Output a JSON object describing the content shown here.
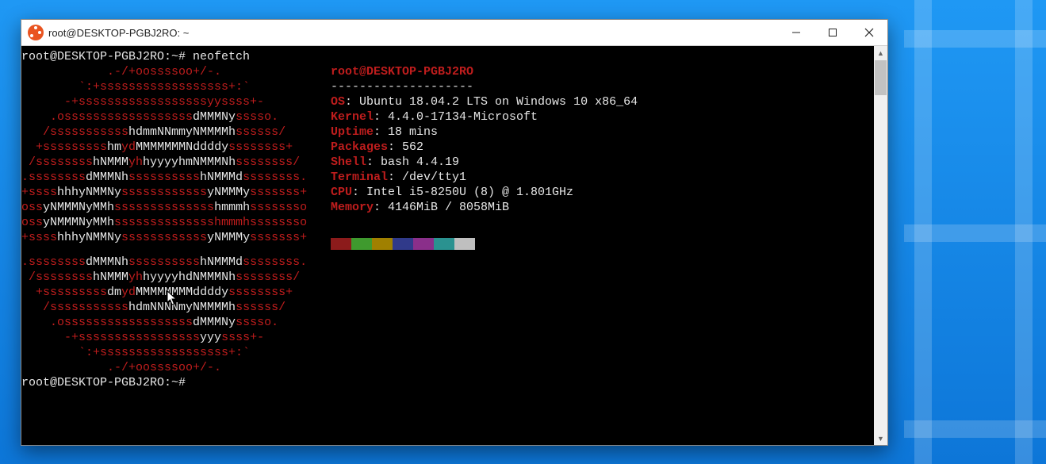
{
  "window": {
    "title": "root@DESKTOP-PGBJ2RO: ~"
  },
  "prompt": {
    "line1": "root@DESKTOP-PGBJ2RO:~# neofetch",
    "line2": "root@DESKTOP-PGBJ2RO:~# "
  },
  "neofetch": {
    "user_host": "root@DESKTOP-PGBJ2RO",
    "dashes": "--------------------",
    "fields": {
      "os_label": "OS",
      "os_value": ": Ubuntu 18.04.2 LTS on Windows 10 x86_64",
      "kernel_label": "Kernel",
      "kernel_value": ": 4.4.0-17134-Microsoft",
      "uptime_label": "Uptime",
      "uptime_value": ": 18 mins",
      "packages_label": "Packages",
      "packages_value": ": 562",
      "shell_label": "Shell",
      "shell_value": ": bash 4.4.19",
      "terminal_label": "Terminal",
      "terminal_value": ": /dev/tty1",
      "cpu_label": "CPU",
      "cpu_value": ": Intel i5-8250U (8) @ 1.801GHz",
      "memory_label": "Memory",
      "memory_value": ": 4146MiB / 8058MiB"
    },
    "swatch_colors": [
      "#8c1b1b",
      "#3f9a2e",
      "#a08000",
      "#303a8a",
      "#8a2f8a",
      "#2a9290",
      "#bfbfbf"
    ]
  },
  "ascii_art_rows": [
    [
      {
        "c": "r",
        "t": "            .-/+oossssoo+/-."
      }
    ],
    [
      {
        "c": "r",
        "t": "        `:+ssssssssssssssssss+:`"
      }
    ],
    [
      {
        "c": "r",
        "t": "      -+ssssssssssssssssssyyssss+-"
      }
    ],
    [
      {
        "c": "r",
        "t": "    .ossssssssssssssssss"
      },
      {
        "c": "w",
        "t": "dMMMNy"
      },
      {
        "c": "r",
        "t": "sssso."
      }
    ],
    [
      {
        "c": "r",
        "t": "   /sssssssssss"
      },
      {
        "c": "w",
        "t": "hdmmNNmmyNMMMMh"
      },
      {
        "c": "r",
        "t": "ssssss/"
      }
    ],
    [
      {
        "c": "r",
        "t": "  +sssssssss"
      },
      {
        "c": "w",
        "t": "hm"
      },
      {
        "c": "r",
        "t": "yd"
      },
      {
        "c": "w",
        "t": "MMMMMMMNddddy"
      },
      {
        "c": "r",
        "t": "ssssssss+"
      }
    ],
    [
      {
        "c": "r",
        "t": " /ssssssss"
      },
      {
        "c": "w",
        "t": "hNMMM"
      },
      {
        "c": "r",
        "t": "yh"
      },
      {
        "c": "w",
        "t": "hyyyyhmNMMMNh"
      },
      {
        "c": "r",
        "t": "ssssssss/"
      }
    ],
    [
      {
        "c": "r",
        "t": ".ssssssss"
      },
      {
        "c": "w",
        "t": "dMMMNh"
      },
      {
        "c": "r",
        "t": "ssssssssss"
      },
      {
        "c": "w",
        "t": "hNMMMd"
      },
      {
        "c": "r",
        "t": "ssssssss."
      }
    ],
    [
      {
        "c": "r",
        "t": "+ssss"
      },
      {
        "c": "w",
        "t": "hhhyNMMNy"
      },
      {
        "c": "r",
        "t": "ssssssssssss"
      },
      {
        "c": "w",
        "t": "yNMMMy"
      },
      {
        "c": "r",
        "t": "sssssss+"
      }
    ],
    [
      {
        "c": "r",
        "t": "oss"
      },
      {
        "c": "w",
        "t": "yNMMMNyMMh"
      },
      {
        "c": "r",
        "t": "ssssssssssssss"
      },
      {
        "c": "w",
        "t": "hmmmh"
      },
      {
        "c": "r",
        "t": "ssssssso"
      }
    ],
    [
      {
        "c": "r",
        "t": "oss"
      },
      {
        "c": "w",
        "t": "yNMMMNyMMh"
      },
      {
        "c": "r",
        "t": "sssssssssssssshmmmhssssssso"
      }
    ],
    [
      {
        "c": "r",
        "t": "+ssss"
      },
      {
        "c": "w",
        "t": "hhhyNMMNy"
      },
      {
        "c": "r",
        "t": "ssssssssssss"
      },
      {
        "c": "w",
        "t": "yNMMMy"
      },
      {
        "c": "r",
        "t": "sssssss+"
      }
    ],
    [
      {
        "c": "r",
        "t": ".ssssssss"
      },
      {
        "c": "w",
        "t": "dMMMNh"
      },
      {
        "c": "r",
        "t": "ssssssssss"
      },
      {
        "c": "w",
        "t": "hNMMMd"
      },
      {
        "c": "r",
        "t": "ssssssss."
      }
    ],
    [
      {
        "c": "r",
        "t": " /ssssssss"
      },
      {
        "c": "w",
        "t": "hNMMM"
      },
      {
        "c": "r",
        "t": "yh"
      },
      {
        "c": "w",
        "t": "hyyyyhdNMMMNh"
      },
      {
        "c": "r",
        "t": "ssssssss/"
      }
    ],
    [
      {
        "c": "r",
        "t": "  +sssssssss"
      },
      {
        "c": "w",
        "t": "dm"
      },
      {
        "c": "r",
        "t": "yd"
      },
      {
        "c": "w",
        "t": "MMMMMMMMddddy"
      },
      {
        "c": "r",
        "t": "ssssssss+"
      }
    ],
    [
      {
        "c": "r",
        "t": "   /sssssssssss"
      },
      {
        "c": "w",
        "t": "hdmNNNNmyNMMMMh"
      },
      {
        "c": "r",
        "t": "ssssss/"
      }
    ],
    [
      {
        "c": "r",
        "t": "    .ossssssssssssssssss"
      },
      {
        "c": "w",
        "t": "dMMMNy"
      },
      {
        "c": "r",
        "t": "sssso."
      }
    ],
    [
      {
        "c": "r",
        "t": "      -+sssssssssssssssss"
      },
      {
        "c": "w",
        "t": "yyy"
      },
      {
        "c": "r",
        "t": "ssss+-"
      }
    ],
    [
      {
        "c": "r",
        "t": "        `:+ssssssssssssssssss+:`"
      }
    ],
    [
      {
        "c": "r",
        "t": "            .-/+oossssoo+/-."
      }
    ]
  ]
}
